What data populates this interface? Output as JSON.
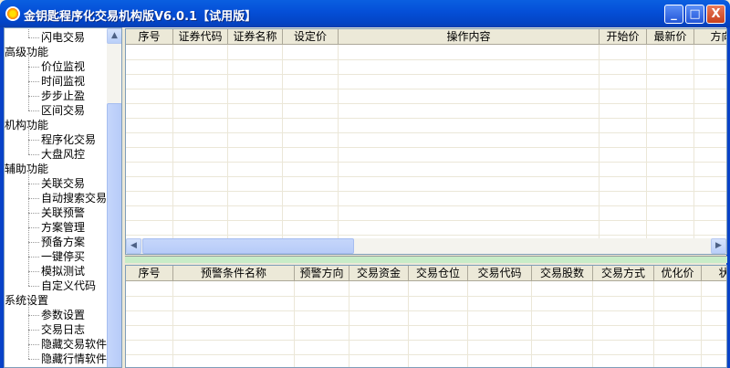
{
  "window": {
    "title": "金钥匙程序化交易机构版V6.0.1【试用版】",
    "minimize": "_",
    "maximize": "□",
    "close": "X"
  },
  "sidebar": {
    "items": [
      {
        "label": "闪电交易",
        "child": true
      },
      {
        "label": "高级功能",
        "child": false
      },
      {
        "label": "价位监视",
        "child": true
      },
      {
        "label": "时间监视",
        "child": true
      },
      {
        "label": "步步止盈",
        "child": true
      },
      {
        "label": "区间交易",
        "child": true
      },
      {
        "label": "机构功能",
        "child": false
      },
      {
        "label": "程序化交易",
        "child": true
      },
      {
        "label": "大盘风控",
        "child": true
      },
      {
        "label": "辅助功能",
        "child": false
      },
      {
        "label": "关联交易",
        "child": true
      },
      {
        "label": "自动搜索交易",
        "child": true
      },
      {
        "label": "关联预警",
        "child": true
      },
      {
        "label": "方案管理",
        "child": true
      },
      {
        "label": "预备方案",
        "child": true
      },
      {
        "label": "一键停买",
        "child": true
      },
      {
        "label": "模拟测试",
        "child": true
      },
      {
        "label": "自定义代码",
        "child": true
      },
      {
        "label": "系统设置",
        "child": false
      },
      {
        "label": "参数设置",
        "child": true
      },
      {
        "label": "交易日志",
        "child": true
      },
      {
        "label": "隐藏交易软件",
        "child": true
      },
      {
        "label": "隐藏行情软件",
        "child": true
      }
    ]
  },
  "top_grid": {
    "columns": [
      "序号",
      "证券代码",
      "证券名称",
      "设定价",
      "操作内容",
      "开始价",
      "最新价",
      "方向"
    ]
  },
  "bottom_grid": {
    "columns": [
      "序号",
      "预警条件名称",
      "预警方向",
      "交易资金",
      "交易仓位",
      "交易代码",
      "交易股数",
      "交易方式",
      "优化价",
      "状态"
    ]
  }
}
